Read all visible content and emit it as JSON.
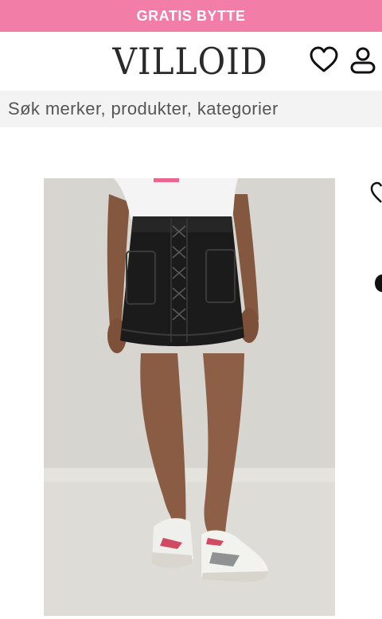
{
  "promo": {
    "text": "GRATIS BYTTE",
    "background": "#f27da6"
  },
  "header": {
    "logo_text": "VILLOID",
    "icons": [
      "heart-icon",
      "user-icon"
    ]
  },
  "search": {
    "placeholder": "Søk merker, produkter, kategorier"
  },
  "product": {
    "image_subject": "model-wearing-black-leather-lace-up-mini-skirt",
    "carousel_controls": [
      "heart-icon",
      "dot-indicator"
    ]
  },
  "colors": {
    "accent_pink": "#f27da6",
    "text_dark": "#2a2a2a",
    "search_bg": "#f3f3f3"
  }
}
